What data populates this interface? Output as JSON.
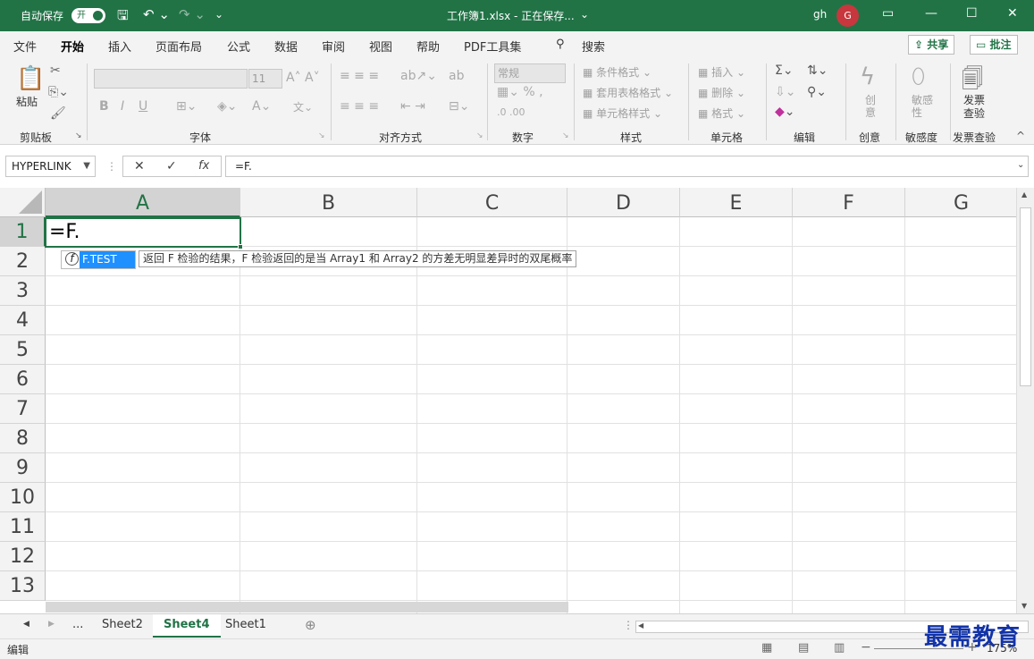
{
  "titlebar": {
    "autosave_label": "自动保存",
    "autosave_state": "开",
    "title": "工作簿1.xlsx - 正在保存...",
    "user": "gh",
    "avatar_letter": "G",
    "accent_color": "#217346"
  },
  "tabs": [
    "文件",
    "开始",
    "插入",
    "页面布局",
    "公式",
    "数据",
    "审阅",
    "视图",
    "帮助",
    "PDF工具集"
  ],
  "active_tab": "开始",
  "search_label": "搜索",
  "share_label": "共享",
  "comment_label": "批注",
  "ribbon": {
    "clipboard": {
      "paste": "粘贴",
      "group": "剪贴板"
    },
    "font": {
      "group": "字体",
      "font_size": "11",
      "bold": "B",
      "italic": "I",
      "underline": "U"
    },
    "alignment": {
      "group": "对齐方式"
    },
    "number": {
      "group": "数字",
      "format": "常规"
    },
    "styles": {
      "group": "样式",
      "conditional": "条件格式",
      "table": "套用表格格式",
      "cell_style": "单元格样式"
    },
    "cells": {
      "group": "单元格",
      "insert": "插入",
      "delete": "删除",
      "format": "格式"
    },
    "editing": {
      "group": "编辑"
    },
    "ideas": {
      "group": "创意",
      "label": "创意"
    },
    "sensitivity": {
      "group": "敏感度",
      "label": "敏感性"
    },
    "invoice": {
      "group": "发票查验",
      "label_line1": "发票",
      "label_line2": "查验"
    }
  },
  "formula_bar": {
    "name_box": "HYPERLINK",
    "formula": "=F."
  },
  "grid": {
    "columns": [
      "A",
      "B",
      "C",
      "D",
      "E",
      "F",
      "G"
    ],
    "rows": [
      "1",
      "2",
      "3",
      "4",
      "5",
      "6",
      "7",
      "8",
      "9",
      "10",
      "11",
      "12",
      "13"
    ],
    "active_cell_text": "=F.",
    "autocomplete_item": "F.TEST",
    "autocomplete_tip": "返回 F 检验的结果，F 检验返回的是当 Array1 和 Array2 的方差无明显差异时的双尾概率"
  },
  "sheets": {
    "ellipsis": "...",
    "items": [
      "Sheet2",
      "Sheet4",
      "Sheet1"
    ],
    "active": "Sheet4"
  },
  "status": {
    "mode": "编辑",
    "zoom": "175%"
  },
  "watermark": "最需教育"
}
